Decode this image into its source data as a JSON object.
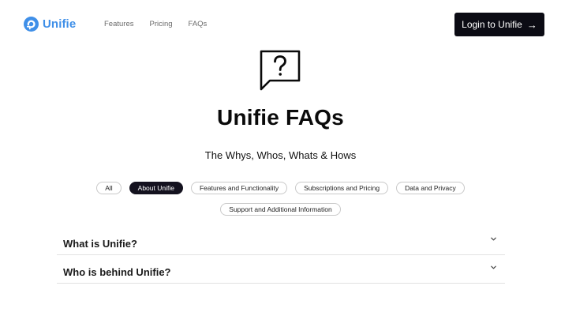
{
  "header": {
    "logo_text": "Unifie",
    "nav": [
      {
        "label": "Features"
      },
      {
        "label": "Pricing"
      },
      {
        "label": "FAQs"
      }
    ],
    "login_label": "Login to Unifie",
    "login_icon": "arrow-right-icon"
  },
  "hero": {
    "icon": "question-bubble-icon",
    "title": "Unifie FAQs",
    "subtitle": "The Whys, Whos, Whats & Hows"
  },
  "filters": {
    "active": "About Unifie",
    "row1": [
      "All",
      "About Unifie",
      "Features and Functionality",
      "Subscriptions and Pricing",
      "Data and Privacy"
    ],
    "row2": [
      "Support and Additional Information"
    ]
  },
  "faqs": [
    {
      "question": "What is Unifie?",
      "icon": "chevron-down-icon"
    },
    {
      "question": "Who is behind Unifie?",
      "icon": "chevron-down-icon"
    }
  ],
  "colors": {
    "brand": "#3f8fe8",
    "primary_dark": "#0b0b14",
    "chip_active": "#14121f"
  }
}
